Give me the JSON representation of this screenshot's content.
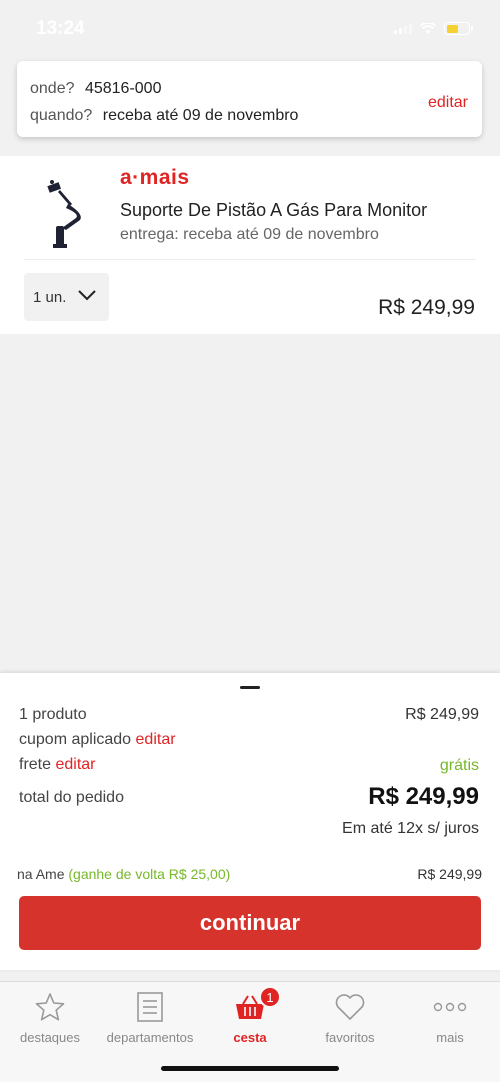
{
  "status_bar": {
    "time": "13:24"
  },
  "location": {
    "where_label": "onde?",
    "where_value": "45816-000",
    "when_label": "quando?",
    "when_value": "receba até 09 de novembro",
    "edit_label": "editar"
  },
  "product": {
    "brand": "a·mais",
    "name": "Suporte De Pistão A Gás Para Monitor",
    "delivery": "entrega: receba até 09 de novembro",
    "quantity": "1 un.",
    "price": "R$ 249,99"
  },
  "summary": {
    "products_label": "1 produto",
    "products_value": "R$ 249,99",
    "coupon_label": "cupom aplicado",
    "coupon_edit": "editar",
    "shipping_label": "frete",
    "shipping_edit": "editar",
    "shipping_value": "grátis",
    "total_label": "total do pedido",
    "total_value": "R$ 249,99",
    "installments": "Em até 12x s/ juros",
    "ame_label": "na Ame",
    "ame_cashback": "(ganhe de volta R$ 25,00)",
    "ame_value": "R$ 249,99",
    "continue_label": "continuar"
  },
  "tabbar": {
    "items": [
      {
        "label": "destaques",
        "icon": "star-icon"
      },
      {
        "label": "departamentos",
        "icon": "list-icon"
      },
      {
        "label": "cesta",
        "icon": "basket-icon",
        "badge": "1"
      },
      {
        "label": "favoritos",
        "icon": "heart-icon"
      },
      {
        "label": "mais",
        "icon": "more-icon"
      }
    ]
  },
  "colors": {
    "accent": "#e02424",
    "button": "#d6332d",
    "green": "#76b82a"
  }
}
